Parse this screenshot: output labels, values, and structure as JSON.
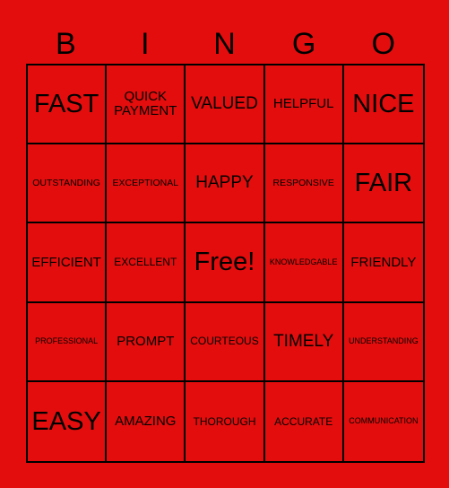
{
  "title_letters": [
    "B",
    "I",
    "N",
    "G",
    "O"
  ],
  "colors": {
    "background": "#E30D0D",
    "lines": "#000000",
    "text": "#000000"
  },
  "cells": [
    {
      "text": "FAST",
      "size": "xl"
    },
    {
      "text": "QUICK PAYMENT",
      "size": "m"
    },
    {
      "text": "VALUED",
      "size": "l"
    },
    {
      "text": "HELPFUL",
      "size": "m"
    },
    {
      "text": "NICE",
      "size": "xl"
    },
    {
      "text": "OUTSTANDING",
      "size": "xs"
    },
    {
      "text": "EXCEPTIONAL",
      "size": "xs"
    },
    {
      "text": "HAPPY",
      "size": "l"
    },
    {
      "text": "RESPONSIVE",
      "size": "xs"
    },
    {
      "text": "FAIR",
      "size": "xl"
    },
    {
      "text": "EFFICIENT",
      "size": "m"
    },
    {
      "text": "EXCELLENT",
      "size": "s"
    },
    {
      "text": "Free!",
      "size": "xl"
    },
    {
      "text": "KNOWLEDGABLE",
      "size": "xxs"
    },
    {
      "text": "FRIENDLY",
      "size": "m"
    },
    {
      "text": "PROFESSIONAL",
      "size": "xxs"
    },
    {
      "text": "PROMPT",
      "size": "m"
    },
    {
      "text": "COURTEOUS",
      "size": "s"
    },
    {
      "text": "TIMELY",
      "size": "l"
    },
    {
      "text": "UNDERSTANDING",
      "size": "xxs"
    },
    {
      "text": "EASY",
      "size": "xl"
    },
    {
      "text": "AMAZING",
      "size": "m"
    },
    {
      "text": "THOROUGH",
      "size": "s"
    },
    {
      "text": "ACCURATE",
      "size": "s"
    },
    {
      "text": "COMMUNICATION",
      "size": "xxs"
    }
  ]
}
